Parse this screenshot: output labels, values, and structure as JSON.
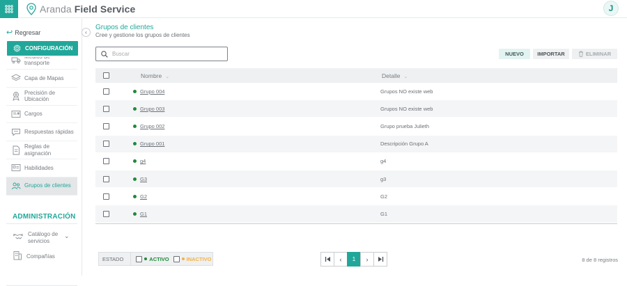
{
  "app": {
    "brand_light": "Aranda",
    "brand_bold": "Field Service",
    "user_initial": "J",
    "accent_color": "#21a79a"
  },
  "sidebar": {
    "back_label": "Regresar",
    "config_label": "CONFIGURACIÓN",
    "items": [
      {
        "label": "Medios de transporte",
        "icon": "truck-icon",
        "active": false
      },
      {
        "label": "Capa de Mapas",
        "icon": "layers-icon",
        "active": false
      },
      {
        "label": "Precisión de Ubicación",
        "icon": "location-pin-icon",
        "active": false
      },
      {
        "label": "Cargos",
        "icon": "id-card-icon",
        "active": false
      },
      {
        "label": "Respuestas rápidas",
        "icon": "chat-icon",
        "active": false
      },
      {
        "label": "Reglas de asignación",
        "icon": "document-icon",
        "active": false
      },
      {
        "label": "Habilidades",
        "icon": "skills-icon",
        "active": false
      },
      {
        "label": "Grupos de clientes",
        "icon": "client-group-icon",
        "active": true
      }
    ],
    "admin_title": "ADMINISTRACIÓN",
    "admin_items": [
      {
        "label": "Catálogo de servicios",
        "icon": "handshake-icon"
      },
      {
        "label": "Compañías",
        "icon": "building-icon"
      }
    ]
  },
  "main": {
    "title": "Grupos de clientes",
    "subtitle": "Cree y gestione los grupos de clientes",
    "search_placeholder": "Buscar",
    "buttons": {
      "new": "NUEVO",
      "import": "IMPORTAR",
      "delete": "ELIMINAR"
    },
    "columns": {
      "name": "Nombre",
      "detail": "Detalle"
    },
    "rows": [
      {
        "name": "Grupo 004",
        "detail": "Grupos NO existe web",
        "status": "activo"
      },
      {
        "name": "Grupo 003",
        "detail": "Grupos NO existe web",
        "status": "activo"
      },
      {
        "name": "Grupo 002",
        "detail": "Grupo prueba Julieth",
        "status": "activo"
      },
      {
        "name": "Grupo 001",
        "detail": "Descripción Grupo A",
        "status": "activo"
      },
      {
        "name": "g4",
        "detail": "g4",
        "status": "activo"
      },
      {
        "name": "G3",
        "detail": "g3",
        "status": "activo"
      },
      {
        "name": "G2",
        "detail": "G2",
        "status": "activo"
      },
      {
        "name": "G1",
        "detail": "G1",
        "status": "activo"
      }
    ]
  },
  "footer": {
    "state_label": "ESTADO",
    "active_label": "ACTIVO",
    "inactive_label": "INACTIVO",
    "current_page": "1",
    "records": "8 de 8 registros",
    "active_color": "#1f8a3b",
    "inactive_color": "#f0b24a"
  }
}
